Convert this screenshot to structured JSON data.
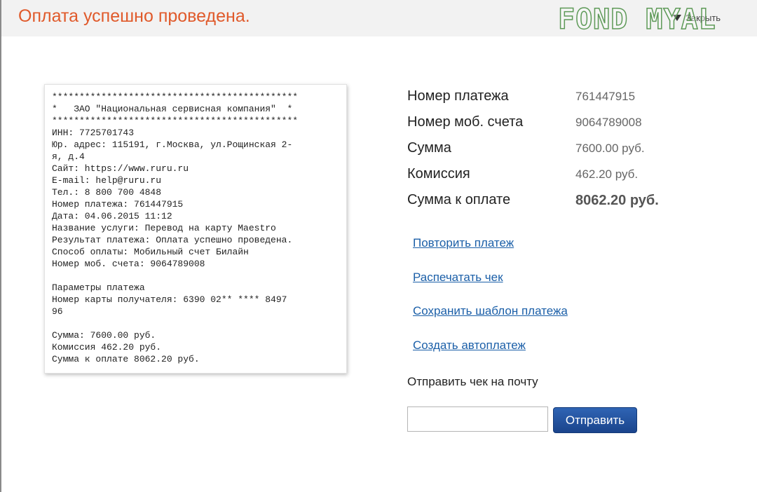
{
  "header": {
    "title": "Оплата успешно проведена.",
    "close_label": "Закрыть",
    "watermark": "FOND MYAL"
  },
  "receipt": {
    "lines": [
      "*********************************************",
      "*   ЗАО \"Национальная сервисная компания\"  *",
      "*********************************************",
      "ИНН: 7725701743",
      "Юр. адрес: 115191, г.Москва, ул.Рощинская 2-",
      "я, д.4",
      "Сайт: https://www.ruru.ru",
      "E-mail: help@ruru.ru",
      "Тел.: 8 800 700 4848",
      "Номер платежа: 761447915",
      "Дата: 04.06.2015 11:12",
      "Название услуги: Перевод на карту Maestro",
      "Результат платежа: Оплата успешно проведена.",
      "Способ оплаты: Мобильный счет Билайн",
      "Номер моб. счета: 9064789008",
      "",
      "Параметры платежа",
      "Номер карты получателя: 6390 02** **** 8497",
      "96",
      "",
      "Сумма: 7600.00 руб.",
      "Комиссия 462.20 руб.",
      "Сумма к оплате 8062.20 руб."
    ]
  },
  "details": {
    "payment_number": {
      "label": "Номер платежа",
      "value": "761447915"
    },
    "mobile_account": {
      "label": "Номер моб. счета",
      "value": "9064789008"
    },
    "amount": {
      "label": "Сумма",
      "value": "7600.00 руб."
    },
    "commission": {
      "label": "Комиссия",
      "value": "462.20 руб."
    },
    "total": {
      "label": "Сумма к оплате",
      "value": "8062.20 руб."
    }
  },
  "actions": {
    "repeat": "Повторить платеж",
    "print": "Распечатать чек",
    "save_template": "Сохранить шаблон платежа",
    "autopay": "Создать автоплатеж"
  },
  "email": {
    "label": "Отправить чек на почту",
    "value": "",
    "button": "Отправить"
  },
  "colors": {
    "title": "#e05a2b",
    "link": "#1b5fa8",
    "button": "#1f4f9c"
  }
}
